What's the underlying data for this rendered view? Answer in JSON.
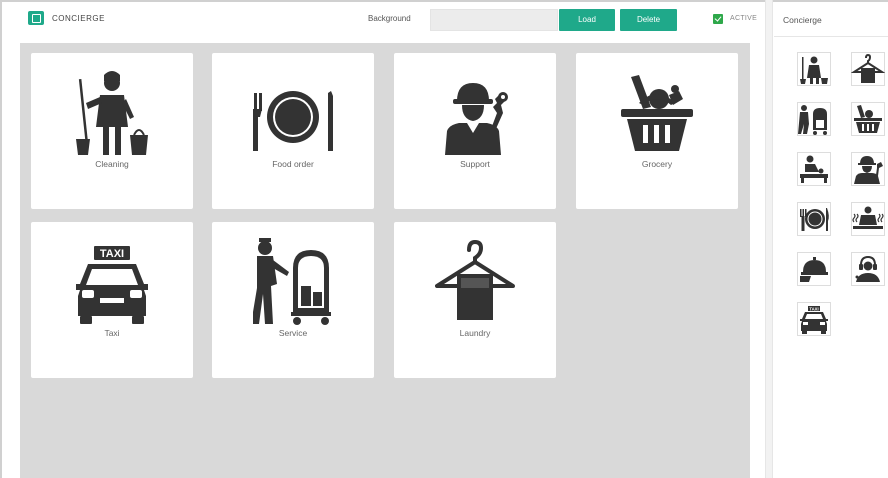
{
  "header": {
    "app_title": "CONCIERGE",
    "background_label": "Background",
    "background_value": "",
    "load_label": "Load",
    "delete_label": "Delete",
    "active_label": "ACTIVE",
    "active_checked": true
  },
  "colors": {
    "accent": "#1fa98a",
    "check": "#2ea84a",
    "canvas": "#d9d9d9",
    "icon": "#333333"
  },
  "tiles": [
    {
      "label": "Cleaning",
      "icon": "cleaning-icon"
    },
    {
      "label": "Food order",
      "icon": "food-order-icon"
    },
    {
      "label": "Support",
      "icon": "support-icon"
    },
    {
      "label": "Grocery",
      "icon": "grocery-icon"
    },
    {
      "label": "Taxi",
      "icon": "taxi-icon",
      "icon_text": "TAXI"
    },
    {
      "label": "Service",
      "icon": "service-icon"
    },
    {
      "label": "Laundry",
      "icon": "laundry-icon"
    }
  ],
  "side_panel": {
    "title": "Concierge",
    "icons": [
      "cleaning-icon",
      "laundry-icon",
      "service-icon",
      "grocery-icon",
      "massage-icon",
      "support-icon",
      "food-order-icon",
      "spa-icon",
      "room-service-icon",
      "operator-icon",
      "taxi-icon"
    ],
    "taxi_text": "TAXI"
  }
}
